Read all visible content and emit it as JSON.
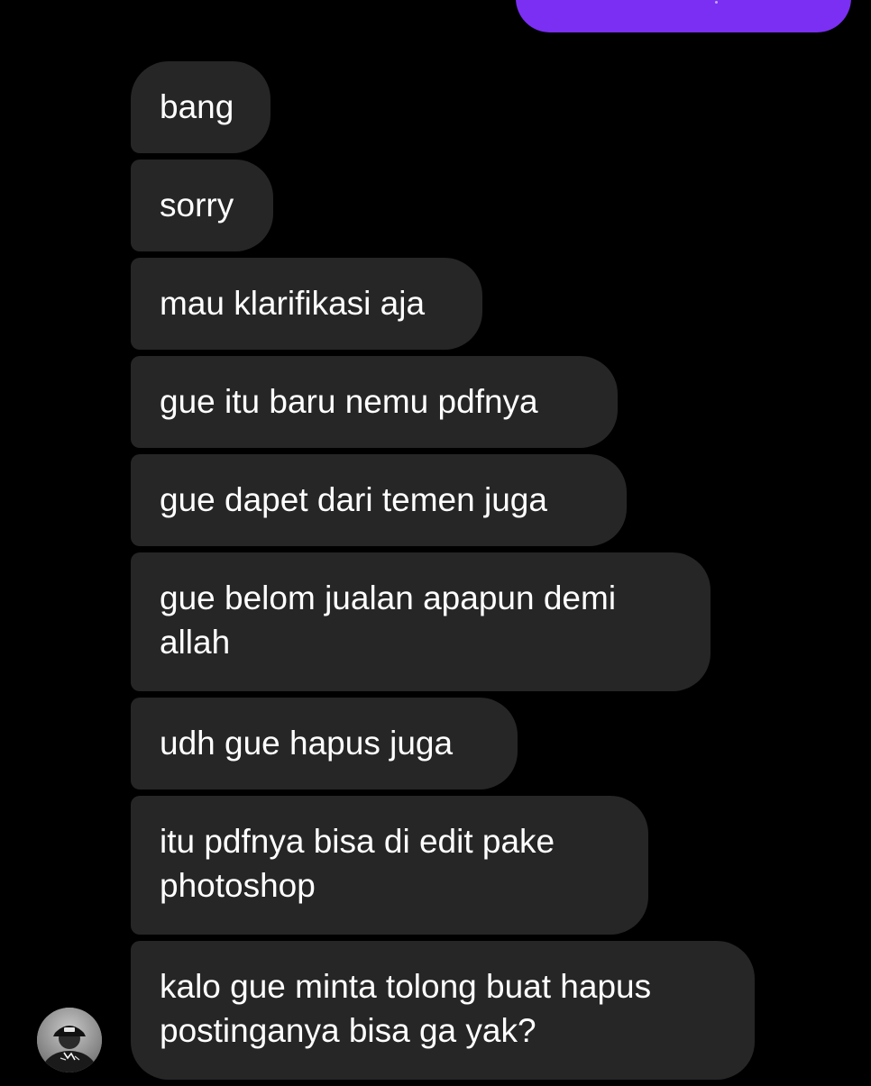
{
  "colors": {
    "background": "#000000",
    "incoming_bubble": "#262626",
    "outgoing_bubble": "#7a2ff2",
    "text": "#ffffff"
  },
  "messages": [
    {
      "text": "bang"
    },
    {
      "text": "sorry"
    },
    {
      "text": "mau klarifikasi aja"
    },
    {
      "text": "gue itu baru nemu pdfnya"
    },
    {
      "text": "gue dapet dari temen juga"
    },
    {
      "text": "gue belom jualan apapun demi allah"
    },
    {
      "text": "udh gue hapus juga"
    },
    {
      "text": "itu pdfnya bisa di edit pake photoshop"
    },
    {
      "text": "kalo gue minta tolong buat hapus postinganya bisa ga yak?"
    }
  ],
  "sender_avatar": {
    "icon": "avatar-photo-icon"
  }
}
